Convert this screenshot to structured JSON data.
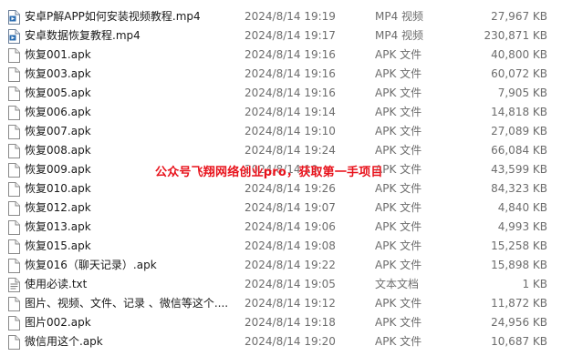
{
  "files": [
    {
      "name": "安卓P解APP如何安装视频教程.mp4",
      "date": "2024/8/14 19:19",
      "type": "MP4 视频",
      "size": "27,967 KB",
      "icon": "video-file-icon"
    },
    {
      "name": "安卓数据恢复教程.mp4",
      "date": "2024/8/14 19:17",
      "type": "MP4 视频",
      "size": "230,871 KB",
      "icon": "video-file-icon"
    },
    {
      "name": "恢复001.apk",
      "date": "2024/8/14 19:16",
      "type": "APK 文件",
      "size": "40,800 KB",
      "icon": "blank-file-icon"
    },
    {
      "name": "恢复003.apk",
      "date": "2024/8/14 19:16",
      "type": "APK 文件",
      "size": "60,072 KB",
      "icon": "blank-file-icon"
    },
    {
      "name": "恢复005.apk",
      "date": "2024/8/14 19:16",
      "type": "APK 文件",
      "size": "7,905 KB",
      "icon": "blank-file-icon"
    },
    {
      "name": "恢复006.apk",
      "date": "2024/8/14 19:14",
      "type": "APK 文件",
      "size": "14,818 KB",
      "icon": "blank-file-icon"
    },
    {
      "name": "恢复007.apk",
      "date": "2024/8/14 19:10",
      "type": "APK 文件",
      "size": "27,089 KB",
      "icon": "blank-file-icon"
    },
    {
      "name": "恢复008.apk",
      "date": "2024/8/14 19:24",
      "type": "APK 文件",
      "size": "66,084 KB",
      "icon": "blank-file-icon"
    },
    {
      "name": "恢复009.apk",
      "date": "2024/8/14 19:",
      "type": "APK 文件",
      "size": "43,599 KB",
      "icon": "blank-file-icon"
    },
    {
      "name": "恢复010.apk",
      "date": "2024/8/14 19:26",
      "type": "APK 文件",
      "size": "84,323 KB",
      "icon": "blank-file-icon"
    },
    {
      "name": "恢复012.apk",
      "date": "2024/8/14 19:07",
      "type": "APK 文件",
      "size": "4,840 KB",
      "icon": "blank-file-icon"
    },
    {
      "name": "恢复013.apk",
      "date": "2024/8/14 19:06",
      "type": "APK 文件",
      "size": "4,993 KB",
      "icon": "blank-file-icon"
    },
    {
      "name": "恢复015.apk",
      "date": "2024/8/14 19:08",
      "type": "APK 文件",
      "size": "15,258 KB",
      "icon": "blank-file-icon"
    },
    {
      "name": "恢复016（聊天记录）.apk",
      "date": "2024/8/14 19:22",
      "type": "APK 文件",
      "size": "15,898 KB",
      "icon": "blank-file-icon"
    },
    {
      "name": "使用必读.txt",
      "date": "2024/8/14 19:05",
      "type": "文本文档",
      "size": "1 KB",
      "icon": "text-file-icon"
    },
    {
      "name": "图片、视频、文件、记录 、微信等这个....",
      "date": "2024/8/14 19:12",
      "type": "APK 文件",
      "size": "11,872 KB",
      "icon": "blank-file-icon"
    },
    {
      "name": "图片002.apk",
      "date": "2024/8/14 19:18",
      "type": "APK 文件",
      "size": "24,956 KB",
      "icon": "blank-file-icon"
    },
    {
      "name": "微信用这个.apk",
      "date": "2024/8/14 19:20",
      "type": "APK 文件",
      "size": "10,687 KB",
      "icon": "blank-file-icon"
    }
  ],
  "watermark": "公众号飞翔网络创业pro，获取第一手项目"
}
